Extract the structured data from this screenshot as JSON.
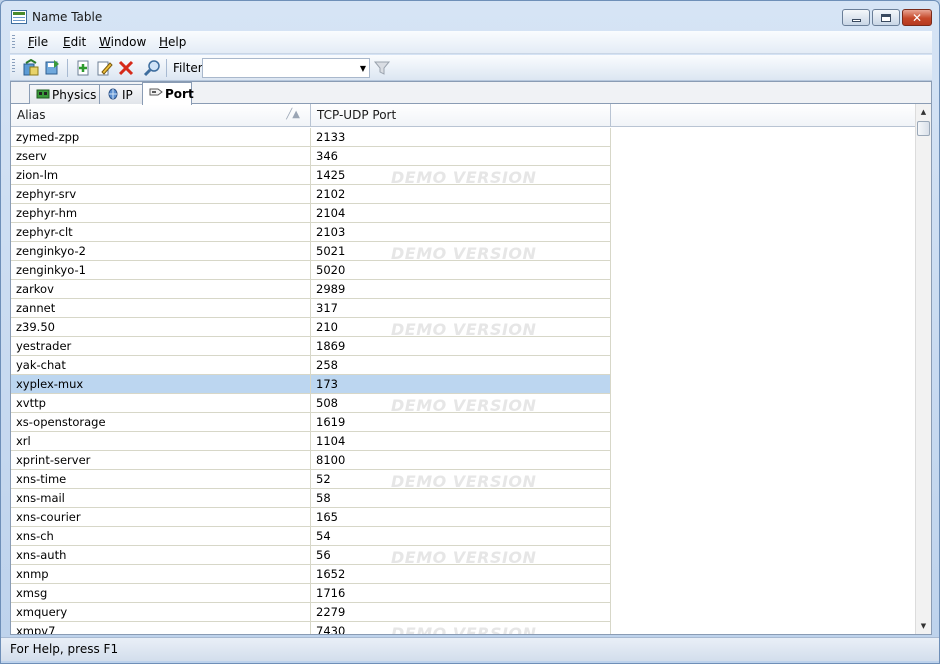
{
  "window": {
    "title": "Name Table"
  },
  "menu": [
    {
      "label": "File",
      "u": "F",
      "rest": "ile"
    },
    {
      "label": "Edit",
      "u": "E",
      "rest": "dit"
    },
    {
      "label": "Window",
      "u": "W",
      "rest": "indow"
    },
    {
      "label": "Help",
      "u": "H",
      "rest": "elp"
    }
  ],
  "toolbar": {
    "filter_label": "Filter",
    "filter_value": ""
  },
  "tabs": [
    {
      "label": "Physics",
      "icon": "physics-icon"
    },
    {
      "label": "IP",
      "icon": "ip-icon"
    },
    {
      "label": "Port",
      "icon": "port-icon",
      "active": true
    }
  ],
  "table": {
    "columns": [
      "Alias",
      "TCP-UDP Port"
    ],
    "watermark": "DEMO VERSION",
    "selected_alias": "xyplex-mux",
    "rows": [
      [
        "zymed-zpp",
        "2133"
      ],
      [
        "zserv",
        "346"
      ],
      [
        "zion-lm",
        "1425"
      ],
      [
        "zephyr-srv",
        "2102"
      ],
      [
        "zephyr-hm",
        "2104"
      ],
      [
        "zephyr-clt",
        "2103"
      ],
      [
        "zenginkyo-2",
        "5021"
      ],
      [
        "zenginkyo-1",
        "5020"
      ],
      [
        "zarkov",
        "2989"
      ],
      [
        "zannet",
        "317"
      ],
      [
        "z39.50",
        "210"
      ],
      [
        "yestrader",
        "1869"
      ],
      [
        "yak-chat",
        "258"
      ],
      [
        "xyplex-mux",
        "173"
      ],
      [
        "xvttp",
        "508"
      ],
      [
        "xs-openstorage",
        "1619"
      ],
      [
        "xrl",
        "1104"
      ],
      [
        "xprint-server",
        "8100"
      ],
      [
        "xns-time",
        "52"
      ],
      [
        "xns-mail",
        "58"
      ],
      [
        "xns-courier",
        "165"
      ],
      [
        "xns-ch",
        "54"
      ],
      [
        "xns-auth",
        "56"
      ],
      [
        "xnmp",
        "1652"
      ],
      [
        "xmsg",
        "1716"
      ],
      [
        "xmquery",
        "2279"
      ],
      [
        "xmpv7",
        "7430"
      ]
    ]
  },
  "status": {
    "text": "For Help, press F1"
  }
}
